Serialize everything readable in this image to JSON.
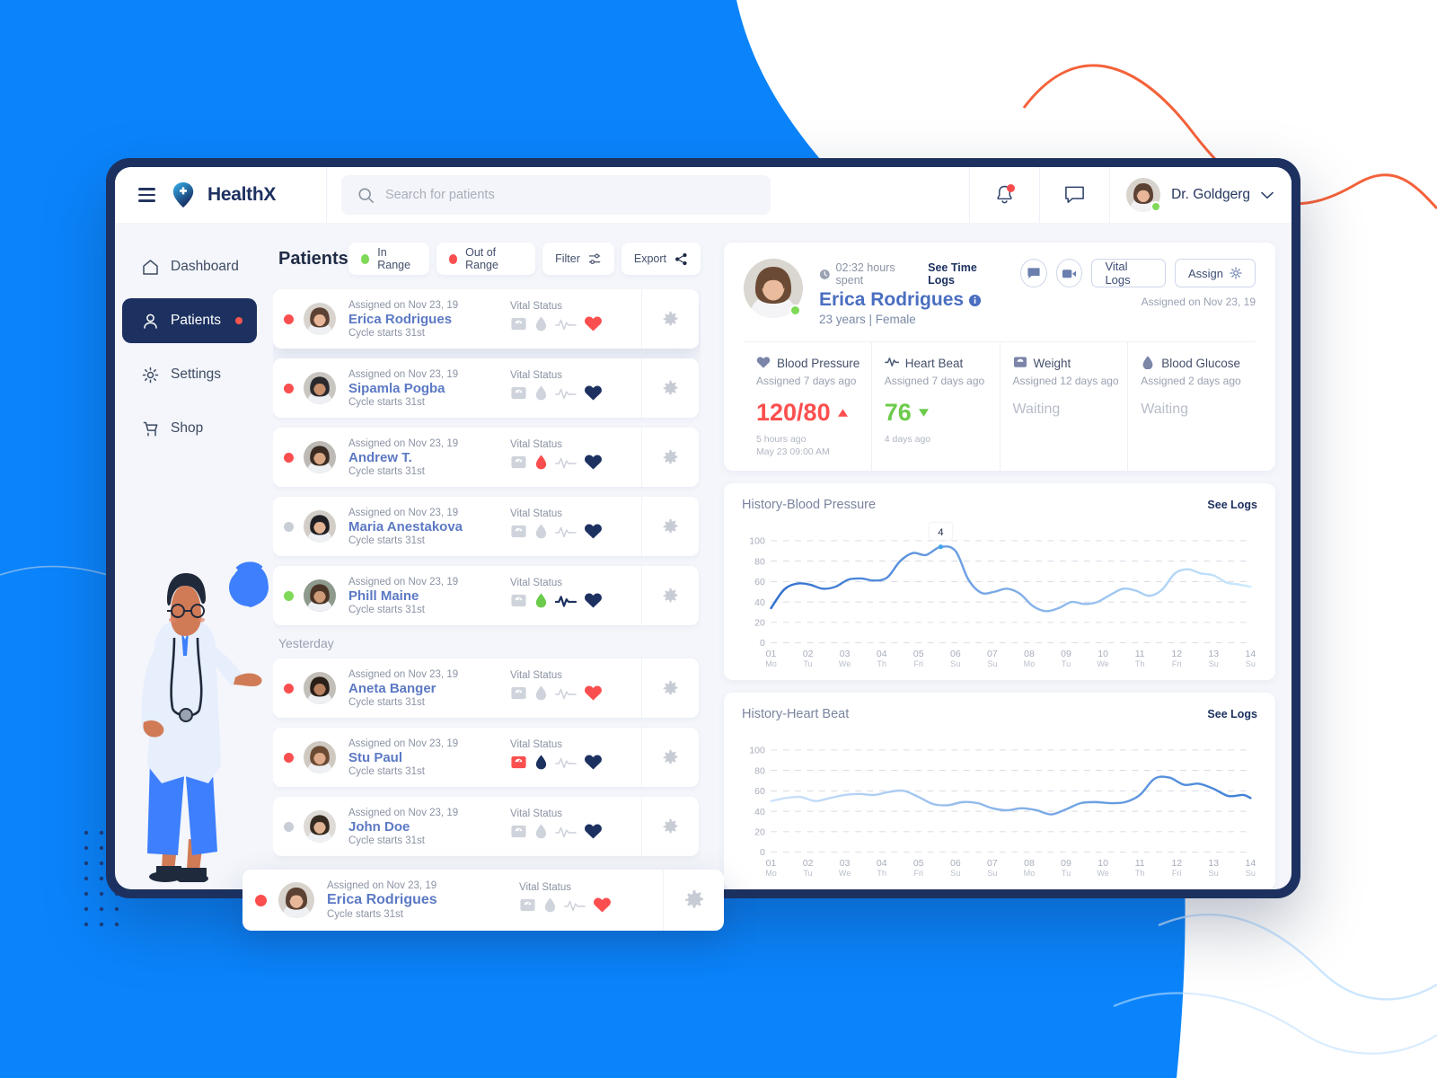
{
  "brand": {
    "name": "HealthX",
    "logo_icon": "location-pin-medical-icon",
    "menu_icon": "hamburger-icon"
  },
  "search": {
    "placeholder": "Search for patients",
    "icon": "search-icon"
  },
  "topbar": {
    "notifications_icon": "bell-icon",
    "messages_icon": "chat-bubble-icon",
    "user_name": "Dr. Goldgerg",
    "chevron_icon": "chevron-down-icon"
  },
  "sidebar": {
    "items": [
      {
        "label": "Dashboard",
        "icon": "home-icon",
        "active": false,
        "dot": false
      },
      {
        "label": "Patients",
        "icon": "user-icon",
        "active": true,
        "dot": true
      },
      {
        "label": "Settings",
        "icon": "gear-icon",
        "active": false,
        "dot": false
      },
      {
        "label": "Shop",
        "icon": "cart-icon",
        "active": false,
        "dot": false
      }
    ]
  },
  "patients_panel": {
    "title": "Patients",
    "tools": [
      {
        "label": "In Range",
        "type": "status",
        "color": "#7ed957"
      },
      {
        "label": "Out of Range",
        "type": "status",
        "color": "#fb4f4f"
      },
      {
        "label": "Filter",
        "type": "filter",
        "icon": "sliders-icon"
      },
      {
        "label": "Export",
        "type": "export",
        "icon": "share-icon"
      }
    ],
    "group_label": "Yesterday",
    "vital_status_label": "Vital Status",
    "gear_icon": "gear-icon",
    "rows": [
      {
        "name": "Erica Rodrigues",
        "assigned": "Assigned on Nov 23, 19",
        "cycle": "Cycle starts 31st",
        "status": "out",
        "vitals": {
          "weight": "off",
          "glucose": "off",
          "pulse": "off",
          "heart": "red"
        },
        "group": "today"
      },
      {
        "name": "Sipamla Pogba",
        "assigned": "Assigned on Nov 23, 19",
        "cycle": "Cycle starts 31st",
        "status": "out",
        "vitals": {
          "weight": "off",
          "glucose": "off",
          "pulse": "off",
          "heart": "navy"
        },
        "group": "today"
      },
      {
        "name": "Andrew T.",
        "assigned": "Assigned on Nov 23, 19",
        "cycle": "Cycle starts 31st",
        "status": "out",
        "vitals": {
          "weight": "off",
          "glucose": "red",
          "pulse": "off",
          "heart": "navy"
        },
        "group": "today"
      },
      {
        "name": "Maria Anestakova",
        "assigned": "Assigned on Nov 23, 19",
        "cycle": "Cycle starts 31st",
        "status": "idle",
        "vitals": {
          "weight": "off",
          "glucose": "off",
          "pulse": "off",
          "heart": "navy"
        },
        "group": "today"
      },
      {
        "name": "Phill Maine",
        "assigned": "Assigned on Nov 23, 19",
        "cycle": "Cycle starts 31st",
        "status": "in",
        "vitals": {
          "weight": "off",
          "glucose": "green",
          "pulse": "navy",
          "heart": "navy"
        },
        "group": "today"
      },
      {
        "name": "Aneta Banger",
        "assigned": "Assigned on Nov 23, 19",
        "cycle": "Cycle starts 31st",
        "status": "out",
        "vitals": {
          "weight": "off",
          "glucose": "off",
          "pulse": "off",
          "heart": "red"
        },
        "group": "yesterday"
      },
      {
        "name": "Stu Paul",
        "assigned": "Assigned on Nov 23, 19",
        "cycle": "Cycle starts 31st",
        "status": "out",
        "vitals": {
          "weight": "red",
          "glucose": "navy",
          "pulse": "off",
          "heart": "navy"
        },
        "group": "yesterday"
      },
      {
        "name": "John Doe",
        "assigned": "Assigned on Nov 23, 19",
        "cycle": "Cycle starts 31st",
        "status": "idle",
        "vitals": {
          "weight": "off",
          "glucose": "off",
          "pulse": "off",
          "heart": "navy"
        },
        "group": "yesterday"
      }
    ]
  },
  "floating_card": {
    "name": "Erica Rodrigues",
    "assigned": "Assigned on Nov 23, 19",
    "cycle": "Cycle starts 31st",
    "vital_status_label": "Vital Status",
    "status": "out",
    "gear_icon": "gear-icon"
  },
  "patient_detail": {
    "hours_spent": "02:32 hours spent",
    "clock_icon": "clock-icon",
    "time_logs_link": "See Time Logs",
    "name": "Erica Rodrigues",
    "info_icon": "info-icon",
    "subtitle": "23 years | Female",
    "assigned": "Assigned on Nov 23, 19",
    "chat_icon": "chat-icon",
    "video_icon": "video-camera-icon",
    "vital_logs_button": "Vital Logs",
    "assign_button": "Assign",
    "assign_gear_icon": "gear-icon",
    "vitals": [
      {
        "title": "Blood Pressure",
        "icon": "heart-icon",
        "icon_color": "#7b85a8",
        "assigned": "Assigned 7 days ago",
        "value": "120/80",
        "state": "red",
        "trend": "up",
        "foot1": "5 hours ago",
        "foot2": "May 23 09:00 AM"
      },
      {
        "title": "Heart Beat",
        "icon": "pulse-icon",
        "icon_color": "#7b85a8",
        "assigned": "Assigned 7 days ago",
        "value": "76",
        "state": "green",
        "trend": "down",
        "foot1": "4 days ago",
        "foot2": ""
      },
      {
        "title": "Weight",
        "icon": "scale-icon",
        "icon_color": "#7b85a8",
        "assigned": "Assigned 12 days ago",
        "value": "Waiting",
        "state": "waiting",
        "trend": "",
        "foot1": "",
        "foot2": ""
      },
      {
        "title": "Blood Glucose",
        "icon": "droplet-icon",
        "icon_color": "#7b85a8",
        "assigned": "Assigned 2 days ago",
        "value": "Waiting",
        "state": "waiting",
        "trend": "",
        "foot1": "",
        "foot2": ""
      }
    ]
  },
  "chart_data": [
    {
      "type": "line",
      "title": "History-Blood Pressure",
      "see_logs_label": "See Logs",
      "xlabel": "",
      "ylabel": "",
      "ylim": [
        0,
        110
      ],
      "yticks": [
        0,
        20,
        40,
        60,
        80,
        100
      ],
      "grid": true,
      "legend": "none",
      "annotation": {
        "label": "4",
        "x_index": 4.6,
        "y_value": 94
      },
      "categories": [
        "01",
        "02",
        "03",
        "04",
        "05",
        "06",
        "07",
        "08",
        "09",
        "10",
        "11",
        "12",
        "13",
        "14"
      ],
      "day_labels": [
        "Mo",
        "Tu",
        "We",
        "Th",
        "Fri",
        "Su",
        "Su",
        "Mo",
        "Tu",
        "We",
        "Th",
        "Fri",
        "Su",
        "Su"
      ],
      "line_color": "#2f6fd0",
      "line_color_end": "#cceaff",
      "x": [
        0,
        0.35,
        0.7,
        1.05,
        1.4,
        1.75,
        2.1,
        2.45,
        2.8,
        3.15,
        3.5,
        3.85,
        4.2,
        4.6,
        5.0,
        5.35,
        5.7,
        6.05,
        6.4,
        6.75,
        7.1,
        7.45,
        7.8,
        8.15,
        8.5,
        8.85,
        9.2,
        9.55,
        9.9,
        10.25,
        10.6,
        10.95,
        11.3,
        11.65,
        12.0,
        12.35,
        12.7,
        13.0
      ],
      "values": [
        34,
        52,
        58,
        57,
        53,
        55,
        62,
        63,
        61,
        64,
        80,
        88,
        86,
        94,
        90,
        62,
        49,
        50,
        53,
        48,
        36,
        31,
        34,
        40,
        38,
        40,
        47,
        53,
        51,
        46,
        52,
        68,
        72,
        68,
        66,
        59,
        57,
        55
      ]
    },
    {
      "type": "line",
      "title": "History-Heart Beat",
      "see_logs_label": "See Logs",
      "xlabel": "",
      "ylabel": "",
      "ylim": [
        0,
        110
      ],
      "yticks": [
        0,
        20,
        40,
        60,
        80,
        100
      ],
      "grid": true,
      "legend": "none",
      "categories": [
        "01",
        "02",
        "03",
        "04",
        "05",
        "06",
        "07",
        "08",
        "09",
        "10",
        "11",
        "12",
        "13",
        "14"
      ],
      "day_labels": [
        "Mo",
        "Tu",
        "We",
        "Th",
        "Fri",
        "Su",
        "Su",
        "Mo",
        "Tu",
        "We",
        "Th",
        "Fri",
        "Su",
        "Su"
      ],
      "line_color": "#cfe4fb",
      "line_color_end": "#3d7fd6",
      "x": [
        0,
        0.4,
        0.8,
        1.2,
        1.6,
        2.0,
        2.4,
        2.8,
        3.2,
        3.6,
        4.0,
        4.4,
        4.8,
        5.2,
        5.6,
        6.0,
        6.4,
        6.8,
        7.2,
        7.6,
        8.0,
        8.4,
        8.8,
        9.2,
        9.6,
        10.0,
        10.4,
        10.8,
        11.2,
        11.6,
        12.0,
        12.4,
        12.8,
        13.0
      ],
      "values": [
        50,
        53,
        54,
        50,
        53,
        56,
        57,
        56,
        59,
        60,
        54,
        47,
        46,
        49,
        48,
        43,
        41,
        43,
        41,
        37,
        42,
        48,
        49,
        48,
        49,
        56,
        72,
        73,
        66,
        67,
        62,
        55,
        56,
        53,
        41
      ]
    }
  ]
}
